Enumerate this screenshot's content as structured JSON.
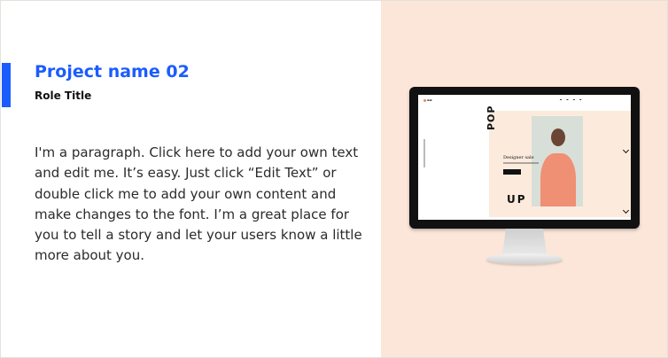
{
  "project": {
    "title": "Project name 02",
    "role": "Role Title",
    "paragraph": "I'm a paragraph. Click here to add your own text and edit me. It’s easy. Just click “Edit Text” or double click me to add your own content and make changes to the font. I’m a great place for you to tell a story and let your users know a little more about you."
  },
  "screen": {
    "hero_top": "POP",
    "hero_bottom": "UP",
    "headline": "Designer sale"
  },
  "colors": {
    "accent": "#1b5cff",
    "panel": "#fbe6d9"
  }
}
